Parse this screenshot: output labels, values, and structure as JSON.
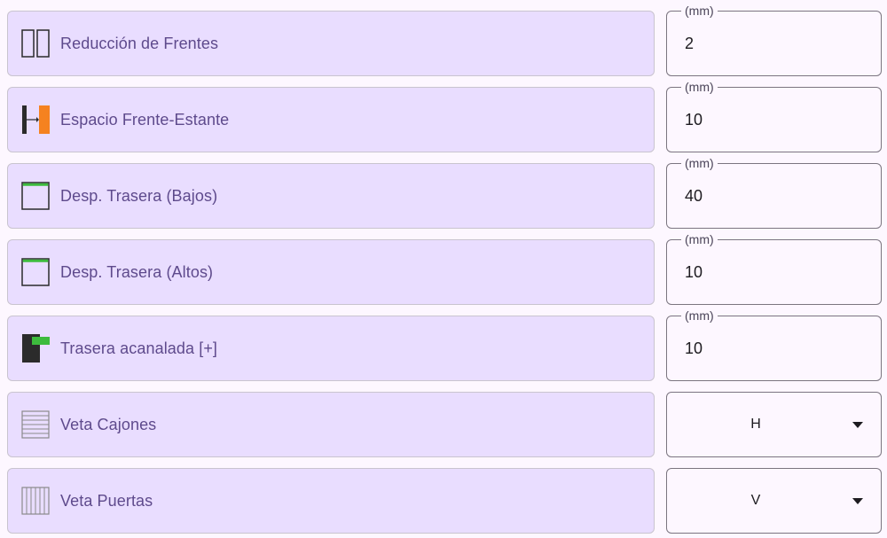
{
  "rows": [
    {
      "label": "Reducción de Frentes",
      "unit": "(mm)",
      "value": "2",
      "icon": "double-panel-icon"
    },
    {
      "label": "Espacio Frente-Estante",
      "unit": "(mm)",
      "value": "10",
      "icon": "front-shelf-gap-icon"
    },
    {
      "label": "Desp. Trasera (Bajos)",
      "unit": "(mm)",
      "value": "40",
      "icon": "back-offset-lower-icon"
    },
    {
      "label": "Desp. Trasera (Altos)",
      "unit": "(mm)",
      "value": "10",
      "icon": "back-offset-upper-icon"
    },
    {
      "label": "Trasera acanalada [+]",
      "unit": "(mm)",
      "value": "10",
      "icon": "grooved-back-icon"
    },
    {
      "label": "Veta Cajones",
      "value": "H",
      "icon": "horizontal-grain-icon"
    },
    {
      "label": "Veta Puertas",
      "value": "V",
      "icon": "vertical-grain-icon"
    }
  ],
  "colors": {
    "card_bg": "#e9ddff",
    "label_text": "#5e4a8c",
    "accent_green": "#3dbb3d",
    "accent_orange": "#f58220",
    "icon_dark": "#2b2b2b"
  }
}
